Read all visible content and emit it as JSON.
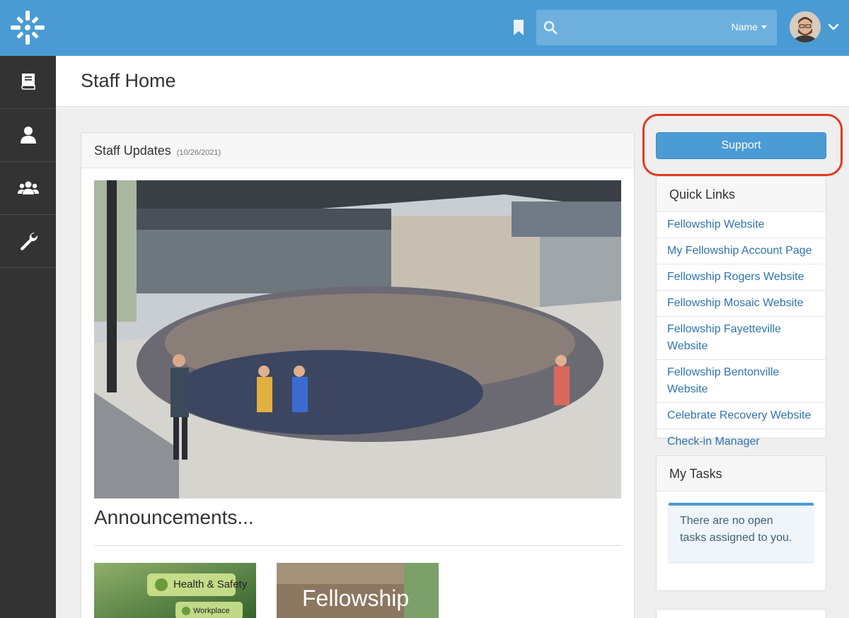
{
  "topbar": {
    "search_type_label": "Name",
    "search_placeholder": ""
  },
  "sidebar": {
    "items": [
      {
        "icon": "book-icon"
      },
      {
        "icon": "person-icon"
      },
      {
        "icon": "group-icon"
      },
      {
        "icon": "wrench-icon"
      }
    ]
  },
  "page": {
    "title": "Staff Home"
  },
  "staff_updates": {
    "title": "Staff Updates",
    "date": "(10/26/2021)",
    "announcements_heading": "Announcements...",
    "thumb1": {
      "line1": "Health & Safety",
      "line2": "Workplace"
    },
    "thumb2": {
      "line1": "Fellowship"
    }
  },
  "support": {
    "label": "Support"
  },
  "quick_links": {
    "title": "Quick Links",
    "items": [
      "Fellowship Website",
      "My Fellowship Account Page",
      "Fellowship Rogers Website",
      "Fellowship Mosaic Website",
      "Fellowship Fayetteville Website",
      "Fellowship Bentonville Website",
      "Celebrate Recovery Website",
      "Check-in Manager"
    ]
  },
  "my_tasks": {
    "title": "My Tasks",
    "empty_message": "There are no open tasks assigned to you."
  },
  "colors": {
    "topbar": "#4a9bd3",
    "sidebar": "#333333",
    "link": "#2f73b0",
    "highlight_ring": "#e03a22"
  }
}
